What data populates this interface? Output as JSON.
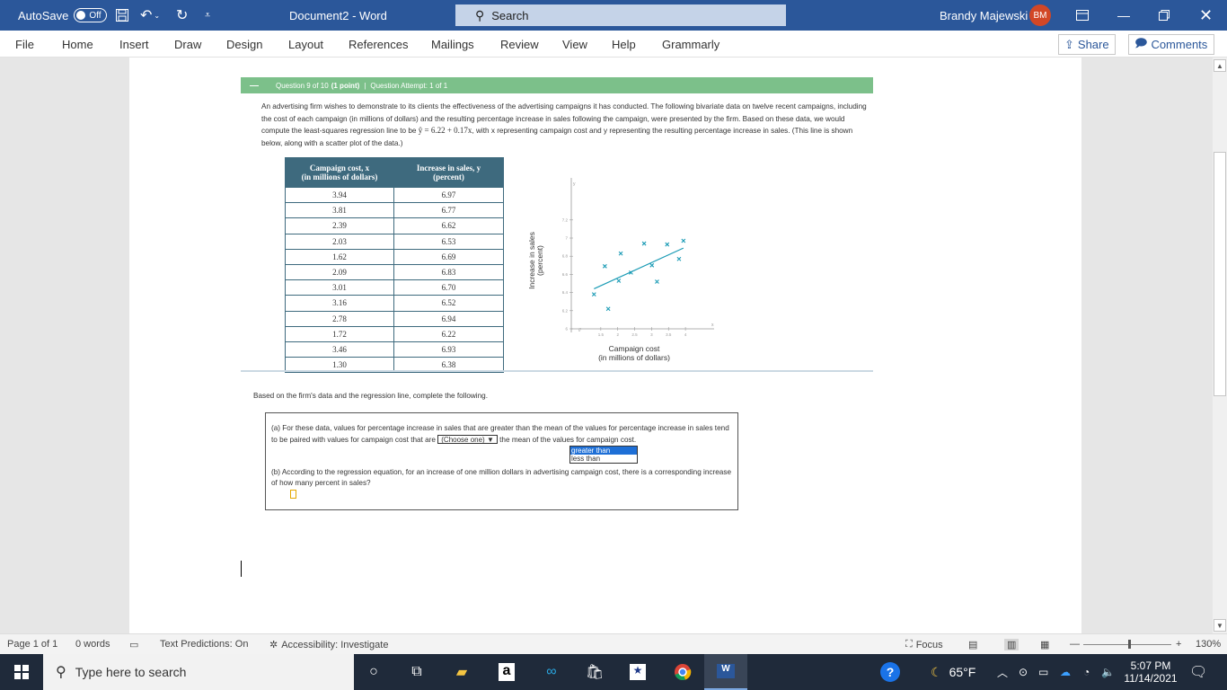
{
  "titlebar": {
    "autosave_label": "AutoSave",
    "autosave_state": "Off",
    "doc_title": "Document2 - Word",
    "search_label": "Search",
    "user_name": "Brandy Majewski",
    "user_initials": "BM"
  },
  "menubar": {
    "items": [
      "File",
      "Home",
      "Insert",
      "Draw",
      "Design",
      "Layout",
      "References",
      "Mailings",
      "Review",
      "View",
      "Help",
      "Grammarly"
    ],
    "share_label": "Share",
    "comments_label": "Comments"
  },
  "question": {
    "header_number": "Question 9 of 10",
    "header_points": "(1 point)",
    "header_attempt": "Question Attempt: 1 of 1",
    "intro_1": "An advertising firm wishes to demonstrate to its clients the effectiveness of the advertising campaigns it has conducted. The following bivariate data on twelve recent campaigns, including the cost of each campaign (in millions of dollars) and the resulting percentage increase in sales following the campaign, were presented by the firm. Based on these data, we would compute the least-squares regression line to be",
    "equation": "ŷ = 6.22 + 0.17x",
    "intro_2": ", with x representing campaign cost and y representing the resulting percentage increase in sales. (This line is shown below, along with a scatter plot of the data.)",
    "table": {
      "headers": [
        [
          "Campaign cost, x",
          "(in millions of dollars)"
        ],
        [
          "Increase in sales, y",
          "(percent)"
        ]
      ],
      "rows": [
        [
          "3.94",
          "6.97"
        ],
        [
          "3.81",
          "6.77"
        ],
        [
          "2.39",
          "6.62"
        ],
        [
          "2.03",
          "6.53"
        ],
        [
          "1.62",
          "6.69"
        ],
        [
          "2.09",
          "6.83"
        ],
        [
          "3.01",
          "6.70"
        ],
        [
          "3.16",
          "6.52"
        ],
        [
          "2.78",
          "6.94"
        ],
        [
          "1.72",
          "6.22"
        ],
        [
          "3.46",
          "6.93"
        ],
        [
          "1.30",
          "6.38"
        ]
      ]
    },
    "prompt": "Based on the firm's data and the regression line, complete the following.",
    "part_a_1": "(a)  For these data, values for percentage increase in sales that are greater than the mean of the values for percentage increase in sales tend to be paired with values for campaign cost that are",
    "part_a_select": "(Choose one)",
    "part_a_2": "the mean of the values for campaign cost.",
    "part_a_options": [
      "greater than",
      "less than"
    ],
    "part_b": "(b)  According to the regression equation, for an increase of one million dollars in advertising campaign cost, there is a corresponding increase of how many percent in sales?"
  },
  "chart_data": {
    "type": "scatter",
    "title": "",
    "xlabel": "Campaign cost (in millions of dollars)",
    "ylabel": "Increase in sales (percent)",
    "x_axis_symbol": "x",
    "y_axis_symbol": "y",
    "xlim": [
      1,
      4.2
    ],
    "ylim": [
      6,
      7.3
    ],
    "x_ticks": [
      "1.5",
      "2",
      "2.5",
      "3",
      "3.5",
      "4"
    ],
    "y_ticks": [
      "6",
      "6.2",
      "6.4",
      "6.6",
      "6.8",
      "7",
      "7.2"
    ],
    "points": [
      [
        3.94,
        6.97
      ],
      [
        3.81,
        6.77
      ],
      [
        2.39,
        6.62
      ],
      [
        2.03,
        6.53
      ],
      [
        1.62,
        6.69
      ],
      [
        2.09,
        6.83
      ],
      [
        3.01,
        6.7
      ],
      [
        3.16,
        6.52
      ],
      [
        2.78,
        6.94
      ],
      [
        1.72,
        6.22
      ],
      [
        3.46,
        6.93
      ],
      [
        1.3,
        6.38
      ]
    ],
    "regression": {
      "intercept": 6.22,
      "slope": 0.17,
      "x_range": [
        1.3,
        3.94
      ]
    },
    "marker": "x",
    "color": "#1a9bb5"
  },
  "statusbar": {
    "page": "Page 1 of 1",
    "words": "0 words",
    "text_predictions": "Text Predictions: On",
    "accessibility": "Accessibility: Investigate",
    "focus": "Focus",
    "zoom": "130%"
  },
  "taskbar": {
    "search_placeholder": "Type here to search",
    "weather": "65°F",
    "time": "5:07 PM",
    "date": "11/14/2021"
  }
}
